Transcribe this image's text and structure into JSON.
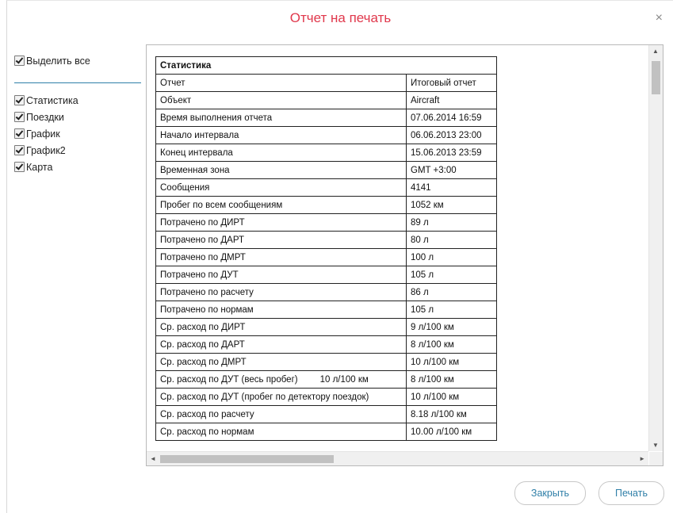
{
  "dialog": {
    "title": "Отчет на печать",
    "close_glyph": "×"
  },
  "left_panel": {
    "select_all": "Выделить все",
    "items": [
      {
        "label": "Статистика",
        "checked": true
      },
      {
        "label": "Поездки",
        "checked": true
      },
      {
        "label": "График",
        "checked": true
      },
      {
        "label": "График2",
        "checked": true
      },
      {
        "label": "Карта",
        "checked": true
      }
    ]
  },
  "table": {
    "header": "Статистика",
    "rows": [
      {
        "label": "Отчет",
        "value": "Итоговый отчет"
      },
      {
        "label": "Объект",
        "value": "Aircraft"
      },
      {
        "label": "Время выполнения отчета",
        "value": "07.06.2014 16:59"
      },
      {
        "label": "Начало интервала",
        "value": "06.06.2013 23:00"
      },
      {
        "label": "Конец интервала",
        "value": "15.06.2013 23:59"
      },
      {
        "label": "Временная зона",
        "value": "GMT +3:00"
      },
      {
        "label": "Сообщения",
        "value": "4141"
      },
      {
        "label": "Пробег по всем сообщениям",
        "value": "1052 км"
      },
      {
        "label": "Потрачено по ДИРТ",
        "value": "89 л"
      },
      {
        "label": "Потрачено по ДАРТ",
        "value": "80 л"
      },
      {
        "label": "Потрачено по ДМРТ",
        "value": "100 л"
      },
      {
        "label": "Потрачено по ДУТ",
        "value": "105 л"
      },
      {
        "label": "Потрачено по расчету",
        "value": "86 л"
      },
      {
        "label": "Потрачено по нормам",
        "value": "105 л"
      },
      {
        "label": "Ср. расход по ДИРТ",
        "value": "9 л/100 км"
      },
      {
        "label": "Ср. расход по ДАРТ",
        "value": "8 л/100 км"
      },
      {
        "label": "Ср. расход по ДМРТ",
        "value": "10 л/100 км"
      },
      {
        "label": "Ср. расход по ДУТ (весь пробег)",
        "extra": "10 л/100 км",
        "value": "8 л/100 км"
      },
      {
        "label": "Ср. расход по ДУТ (пробег по детектору поездок)",
        "value": "10 л/100 км"
      },
      {
        "label": "Ср. расход по расчету",
        "value": "8.18 л/100 км"
      },
      {
        "label": "Ср. расход по нормам",
        "value": "10.00 л/100 км"
      }
    ]
  },
  "scrollbars": {
    "up_arrow": "▲",
    "down_arrow": "▼",
    "left_arrow": "◄",
    "right_arrow": "►"
  },
  "buttons": {
    "close_label": "Закрыть",
    "print_label": "Печать"
  }
}
